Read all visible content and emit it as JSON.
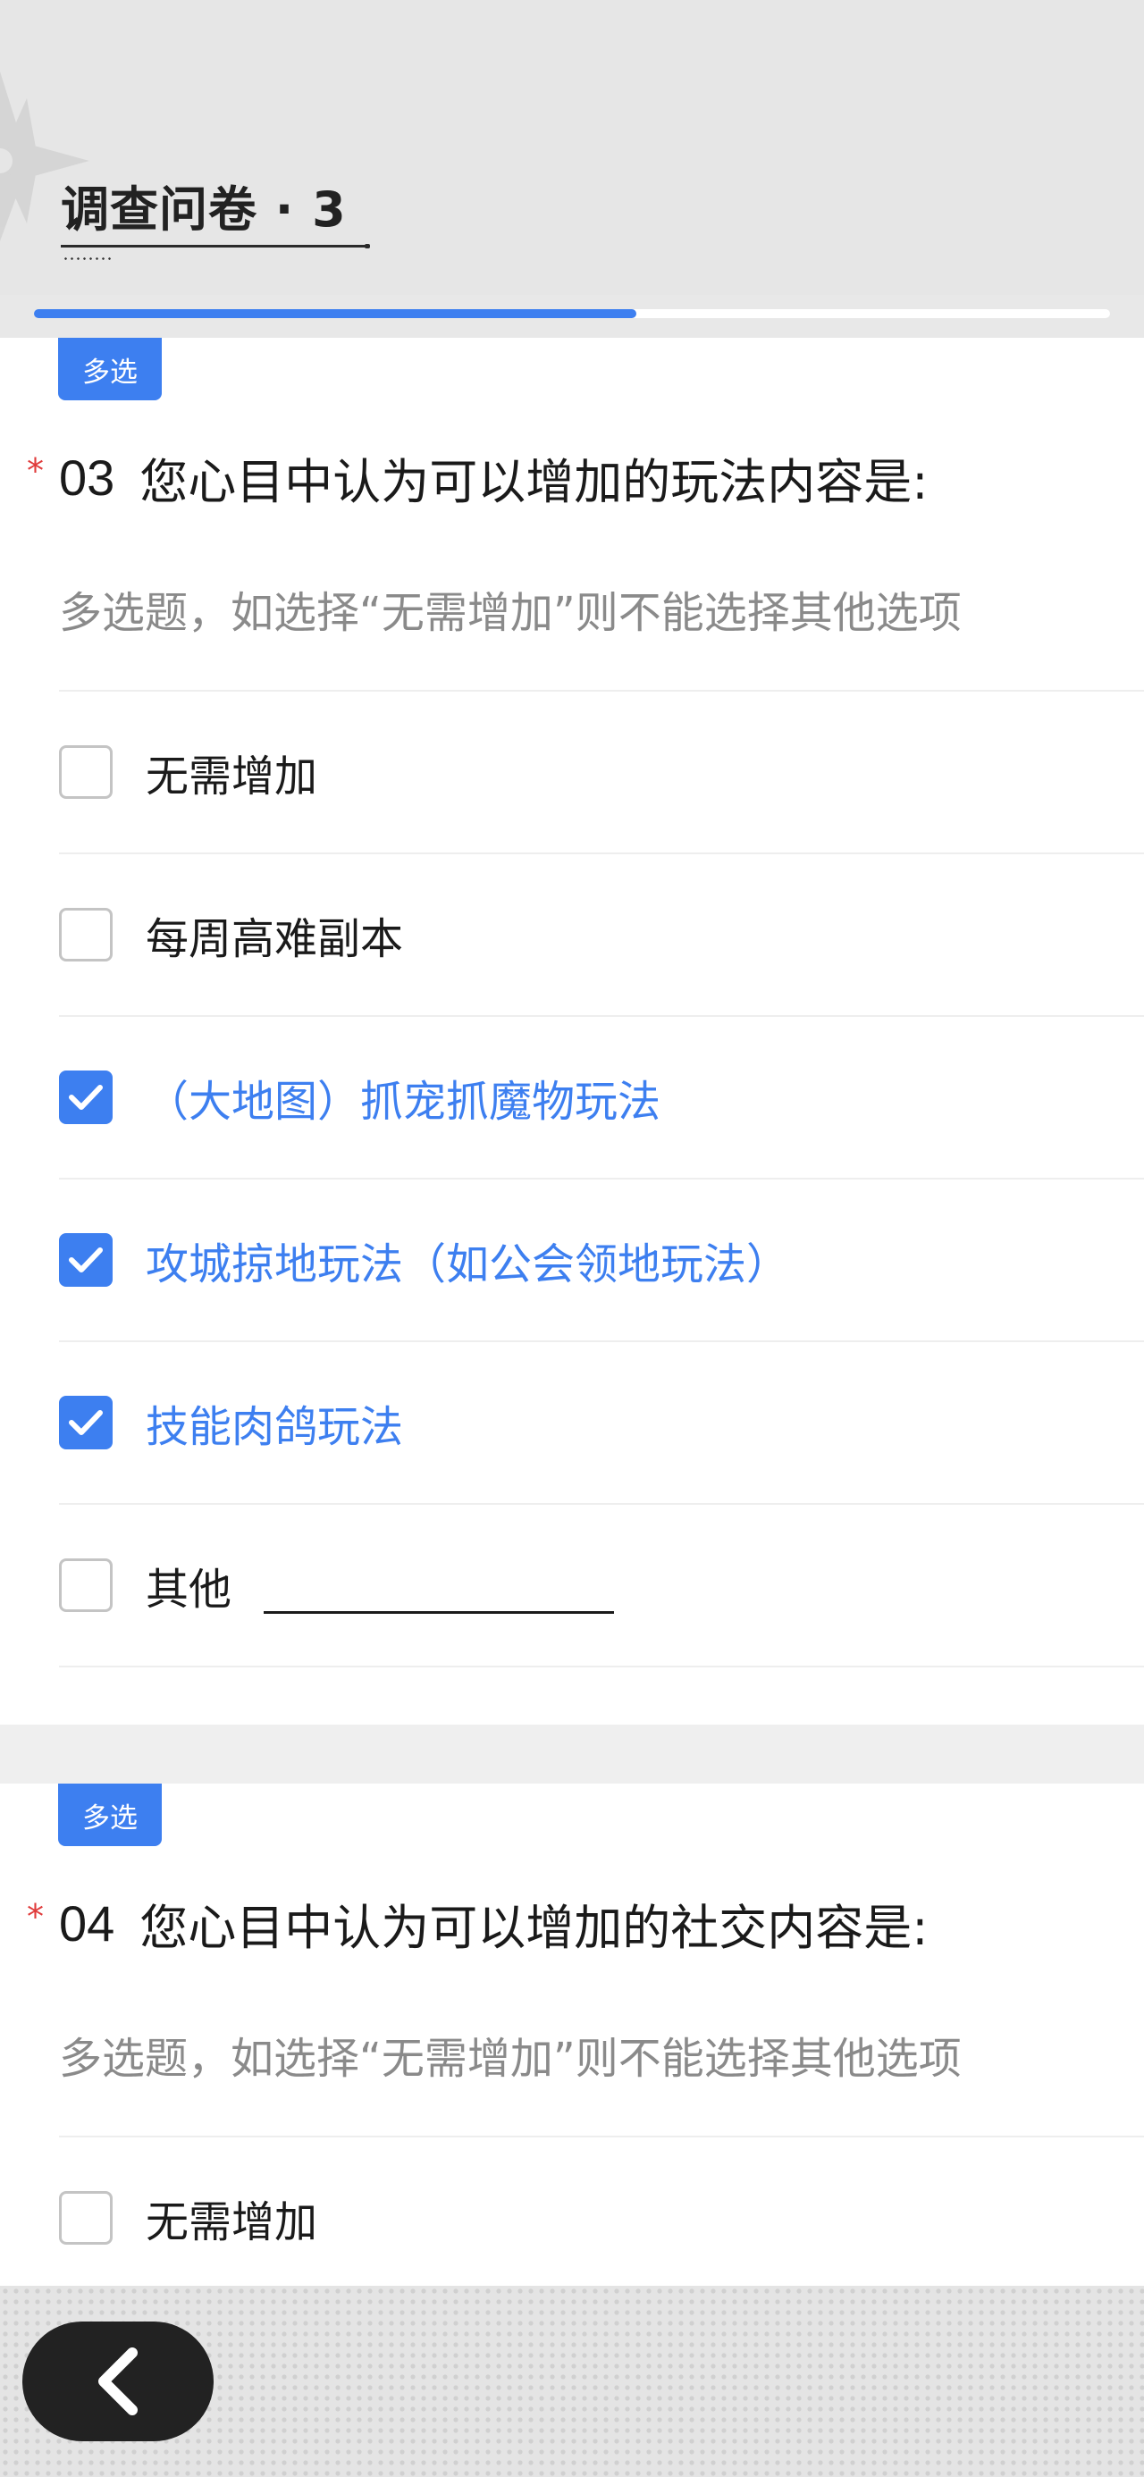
{
  "header": {
    "title": "调查问卷 · 3",
    "progress_fraction": 0.56
  },
  "questions": [
    {
      "badge": "多选",
      "required_mark": "*",
      "number": "03",
      "text": "您心目中认为可以增加的玩法内容是:",
      "description": "多选题，如选择“无需增加”则不能选择其他选项",
      "options": [
        {
          "label": "无需增加",
          "checked": false
        },
        {
          "label": "每周高难副本",
          "checked": false
        },
        {
          "label": "（大地图）抓宠抓魔物玩法",
          "checked": true
        },
        {
          "label": "攻城掠地玩法（如公会领地玩法）",
          "checked": true
        },
        {
          "label": "技能肉鸽玩法",
          "checked": true
        },
        {
          "label": "其他",
          "checked": false,
          "has_text_input": true,
          "input_value": ""
        }
      ]
    },
    {
      "badge": "多选",
      "required_mark": "*",
      "number": "04",
      "text": "您心目中认为可以增加的社交内容是:",
      "description": "多选题，如选择“无需增加”则不能选择其他选项",
      "options": [
        {
          "label": "无需增加",
          "checked": false
        }
      ]
    }
  ],
  "colors": {
    "accent": "#3d7ff0",
    "required": "#e03b3b",
    "header_bg": "#e6e6e6",
    "back_button_bg": "#222222"
  },
  "icons": {
    "back": "chevron-left-icon",
    "check": "checkmark-icon",
    "decoration": "star-ornament-icon"
  }
}
